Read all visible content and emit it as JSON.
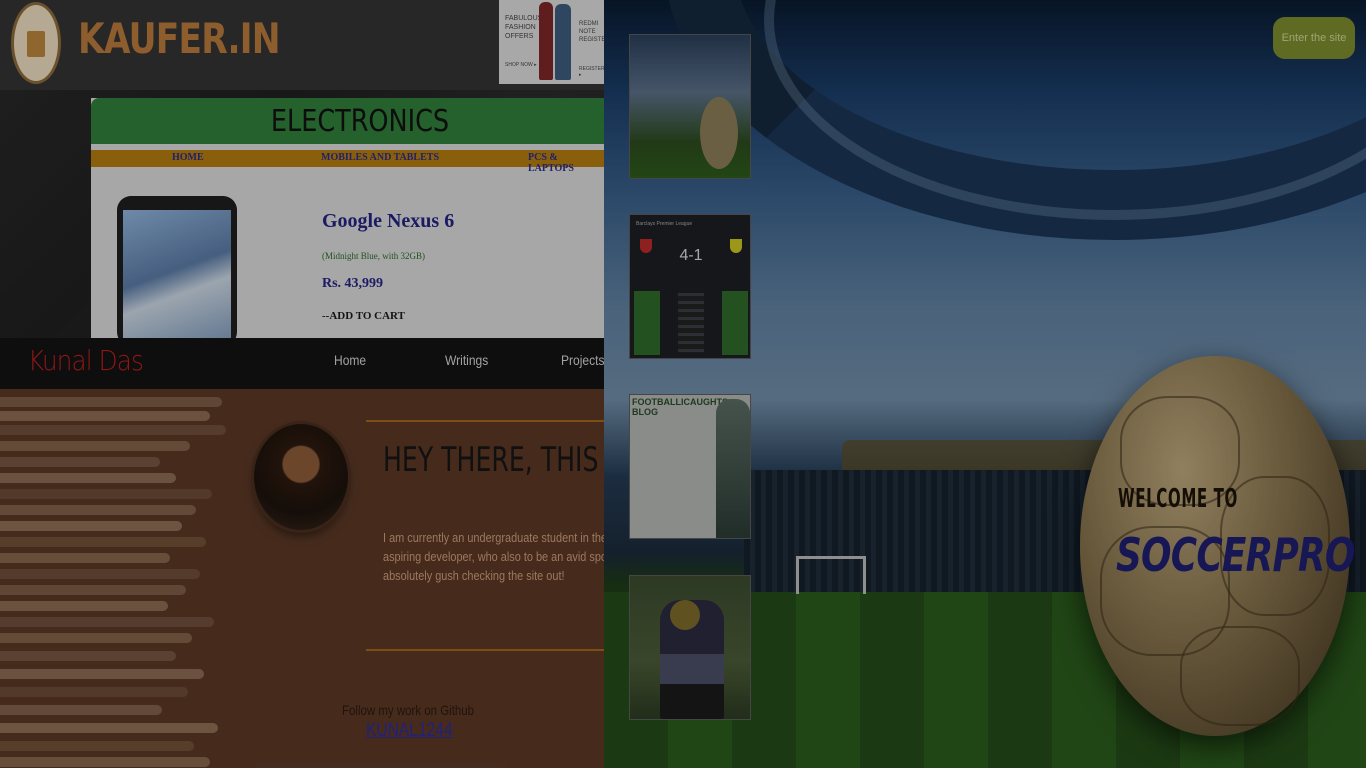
{
  "kaufer": {
    "site_title": "KAUFER.IN",
    "ad_text_left": "FABULOUS FASHION OFFERS",
    "ad_more_left": "SHOP NOW ▸",
    "ad_text_right": "REDMI NOTE REGISTER",
    "ad_more_right": "REGISTER ▸",
    "category_banner": "ELECTRONICS",
    "nav": [
      "HOME",
      "MOBILES AND TABLETS",
      "PCS & LAPTOPS"
    ],
    "product": {
      "title": "Google Nexus 6",
      "subtitle": "(Midnight Blue, with 32GB)",
      "price": "Rs. 43,999",
      "cart_label": "--ADD TO CART"
    }
  },
  "kunal": {
    "brand": "Kunal Das",
    "nav": [
      "Home",
      "Writings",
      "Projects"
    ],
    "heading": "HEY THERE, THIS IS K",
    "bio": "I am currently an undergraduate student in the Kharagpur. I am an aspiring developer, who also to be an avid sport lover, and I absolutely gush checking the site out!",
    "follow_text": "Follow my work on Github",
    "github_handle": "KUNAL1244"
  },
  "soccer": {
    "enter_button": "Enter the site",
    "welcome": "WELCOME TO",
    "brand": "SOCCERPRO",
    "thumb_score": "4-1",
    "thumb_league": "Barclays Premier League",
    "thumb_blog_title": "FOOTBALLICAUGHTS BLOG"
  },
  "colors": {
    "kaufer_orange": "#b5783a",
    "banner_green": "#2f7d3a",
    "nav_gold": "#b07a10",
    "link_blue": "#232380",
    "kunal_red": "#b81e1e",
    "soccer_button": "#7a8a2c"
  }
}
